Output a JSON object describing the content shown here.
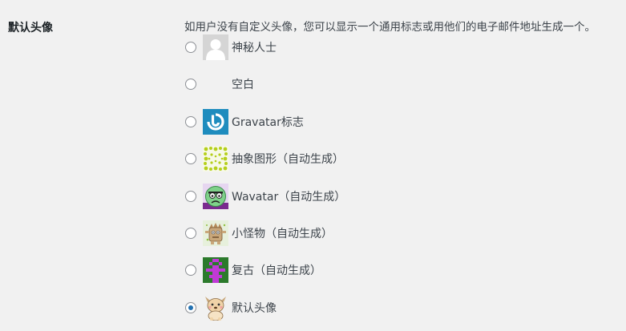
{
  "setting": {
    "label": "默认头像",
    "description": "如用户没有自定义头像，您可以显示一个通用标志或用他们的电子邮件地址生成一个。"
  },
  "options": [
    {
      "label": "神秘人士",
      "icon": "mystery-person-icon",
      "checked": false
    },
    {
      "label": "空白",
      "icon": "blank-icon",
      "checked": false
    },
    {
      "label": "Gravatar标志",
      "icon": "gravatar-logo-icon",
      "checked": false
    },
    {
      "label": "抽象图形（自动生成）",
      "icon": "identicon-icon",
      "checked": false
    },
    {
      "label": "Wavatar（自动生成）",
      "icon": "wavatar-icon",
      "checked": false
    },
    {
      "label": "小怪物（自动生成）",
      "icon": "monsterid-icon",
      "checked": false
    },
    {
      "label": "复古（自动生成）",
      "icon": "retro-icon",
      "checked": false
    },
    {
      "label": "默认头像",
      "icon": "default-avatar-icon",
      "checked": true
    }
  ],
  "colors": {
    "background": "#f1f1f1",
    "radio_checked": "#2271b1",
    "gravatar_blue": "#1e8cbe",
    "retro_green": "#2c7a2c",
    "retro_purple": "#c03ad6"
  }
}
